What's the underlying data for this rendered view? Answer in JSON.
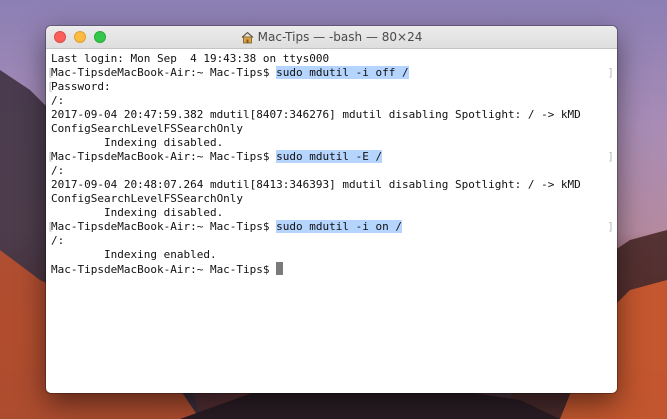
{
  "window": {
    "title": "Mac-Tips — -bash — 80×24"
  },
  "terminal": {
    "lines": {
      "l0": "Last login: Mon Sep  4 19:43:38 on ttys000",
      "l1_prompt": "Mac-TipsdeMacBook-Air:~ Mac-Tips$ ",
      "l1_cmd": "sudo mdutil -i off /",
      "l2": "Password:",
      "l3": "/:",
      "l4": "2017-09-04 20:47:59.382 mdutil[8407:346276] mdutil disabling Spotlight: / -> kMD",
      "l5": "ConfigSearchLevelFSSearchOnly",
      "l6": "        Indexing disabled.",
      "l7_prompt": "Mac-TipsdeMacBook-Air:~ Mac-Tips$ ",
      "l7_cmd": "sudo mdutil -E /",
      "l8": "/:",
      "l9": "2017-09-04 20:48:07.264 mdutil[8413:346393] mdutil disabling Spotlight: / -> kMD",
      "l10": "ConfigSearchLevelFSSearchOnly",
      "l11": "        Indexing disabled.",
      "l12_prompt": "Mac-TipsdeMacBook-Air:~ Mac-Tips$ ",
      "l12_cmd": "sudo mdutil -i on /",
      "l13": "/:",
      "l14": "        Indexing enabled.",
      "l15_prompt": "Mac-TipsdeMacBook-Air:~ Mac-Tips$ "
    },
    "bracket_left": "[",
    "bracket_right": "]"
  },
  "icons": {
    "title_icon": "home-icon"
  },
  "colors": {
    "selection": "#b5d5ff",
    "close": "#fc605b",
    "minimize": "#fdbc40",
    "zoom": "#34c84a"
  }
}
